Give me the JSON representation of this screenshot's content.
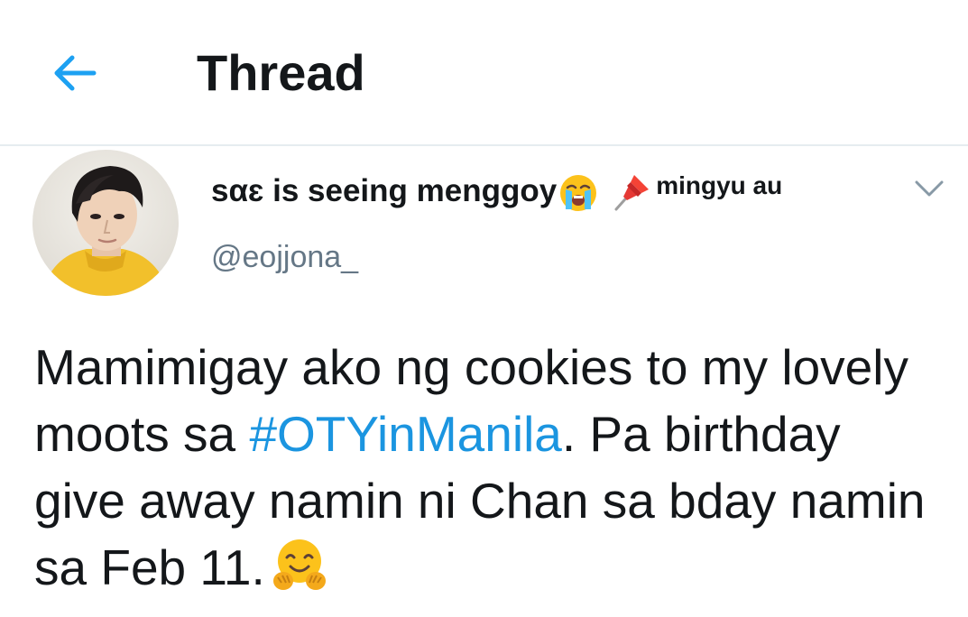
{
  "header": {
    "title": "Thread",
    "back_icon": "arrow-left-icon",
    "accent_color": "#1da1f2"
  },
  "tweet": {
    "display_name": "sαɛ is seeing menggoy",
    "name_suffix": "mingyu au",
    "handle": "@eojjona_",
    "text_part1": "Mamimigay ako ng cookies to my lovely moots sa ",
    "hashtag": "#OTYinManila",
    "text_part2": ". Pa birthday give away namin ni Chan sa bday namin sa Feb 11.",
    "hashtag_color": "#1b95e0",
    "icons": [
      "loudly-crying-face-icon",
      "pushpin-icon",
      "hugging-face-icon",
      "chevron-down-icon"
    ]
  }
}
